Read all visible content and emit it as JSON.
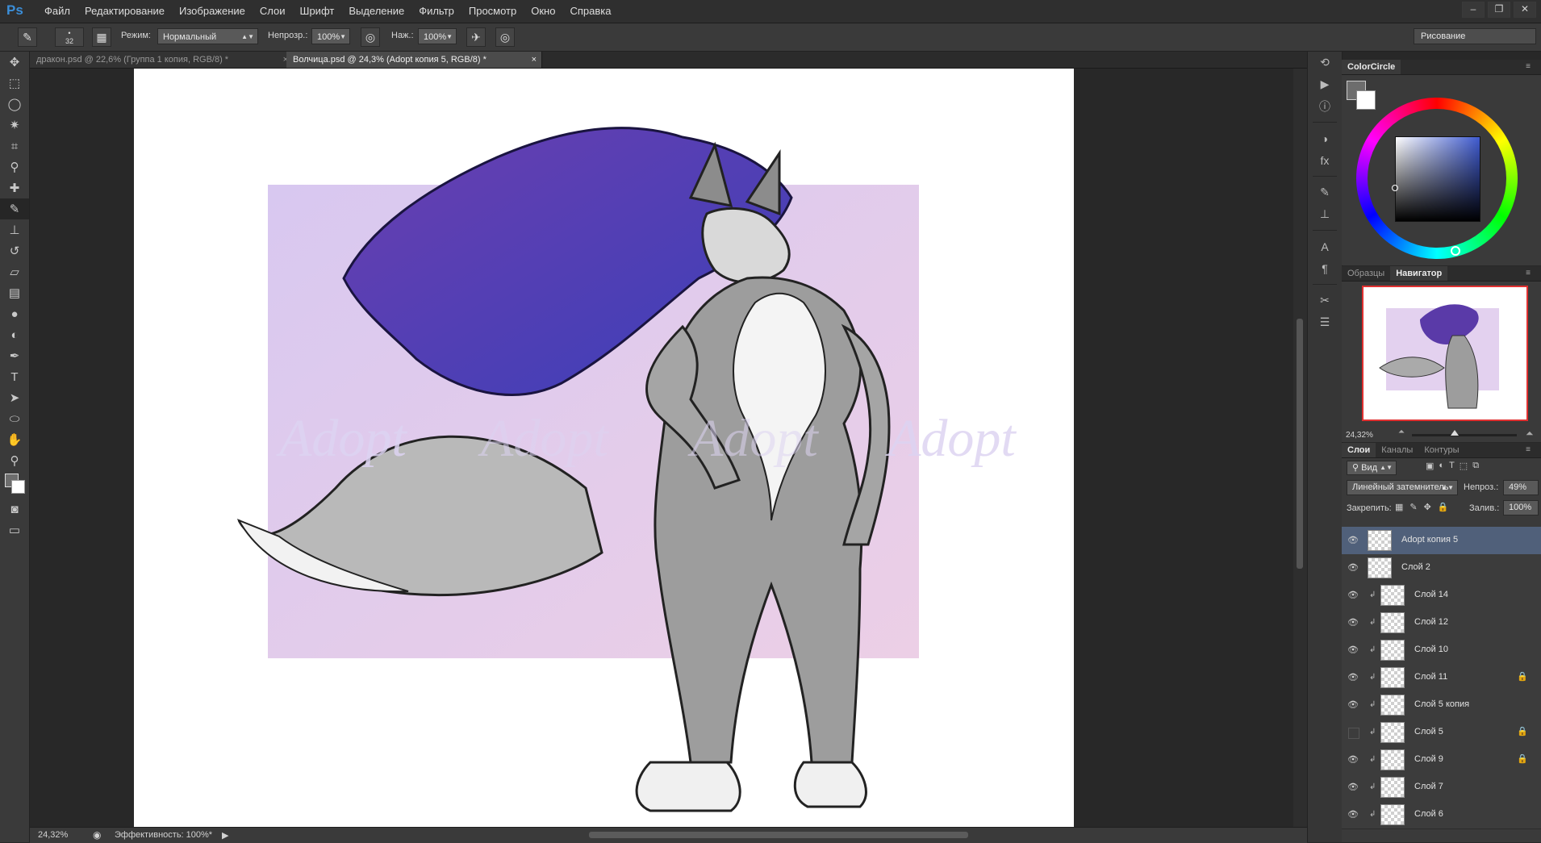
{
  "app": {
    "logo": "Ps"
  },
  "menu": [
    "Файл",
    "Редактирование",
    "Изображение",
    "Слои",
    "Шрифт",
    "Выделение",
    "Фильтр",
    "Просмотр",
    "Окно",
    "Справка"
  ],
  "window_controls": {
    "minimize": "–",
    "restore": "❐",
    "close": "✕"
  },
  "options": {
    "brush_size": "32",
    "mode_label": "Режим:",
    "mode_value": "Нормальный",
    "opacity_label": "Непрозр.:",
    "opacity_value": "100%",
    "pressure_label": "Наж.:",
    "pressure_value": "100%",
    "workspace": "Рисование"
  },
  "tabs": [
    {
      "label": "дракон.psd @ 22,6% (Группа 1 копия, RGB/8) *",
      "close": "×",
      "active": false
    },
    {
      "label": "Волчица.psd @ 24,3% (Adopt копия 5, RGB/8) *",
      "close": "×",
      "active": true
    }
  ],
  "artwork": {
    "watermark": "Adopt",
    "bg_color": "#e8d5ee",
    "hair_color": "#5a3aa8"
  },
  "status": {
    "zoom": "24,32%",
    "efficiency": "Эффективность: 100%*"
  },
  "colorcircle": {
    "title": "ColorCircle"
  },
  "navigator": {
    "tab_swatches": "Образцы",
    "tab_navigator": "Навигатор",
    "zoom": "24,32%"
  },
  "layers_panel": {
    "tab_layers": "Слои",
    "tab_channels": "Каналы",
    "tab_paths": "Контуры",
    "filter_label": "Вид",
    "blend_mode": "Линейный затемнитель",
    "opacity_label": "Непроз.:",
    "opacity_value": "49%",
    "lock_label": "Закрепить:",
    "fill_label": "Залив.:",
    "fill_value": "100%"
  },
  "layers": [
    {
      "name": "Adopt копия 5",
      "visible": true,
      "selected": true,
      "clipped": false,
      "locked": false
    },
    {
      "name": "Слой 2",
      "visible": true,
      "selected": false,
      "clipped": false,
      "locked": false
    },
    {
      "name": "Слой 14",
      "visible": true,
      "selected": false,
      "clipped": true,
      "locked": false
    },
    {
      "name": "Слой 12",
      "visible": true,
      "selected": false,
      "clipped": true,
      "locked": false
    },
    {
      "name": "Слой 10",
      "visible": true,
      "selected": false,
      "clipped": true,
      "locked": false
    },
    {
      "name": "Слой 11",
      "visible": true,
      "selected": false,
      "clipped": true,
      "locked": true
    },
    {
      "name": "Слой 5 копия",
      "visible": true,
      "selected": false,
      "clipped": true,
      "locked": false
    },
    {
      "name": "Слой 5",
      "visible": false,
      "selected": false,
      "clipped": true,
      "locked": true
    },
    {
      "name": "Слой 9",
      "visible": true,
      "selected": false,
      "clipped": true,
      "locked": true
    },
    {
      "name": "Слой 7",
      "visible": true,
      "selected": false,
      "clipped": true,
      "locked": false
    },
    {
      "name": "Слой 6",
      "visible": true,
      "selected": false,
      "clipped": true,
      "locked": false
    }
  ]
}
